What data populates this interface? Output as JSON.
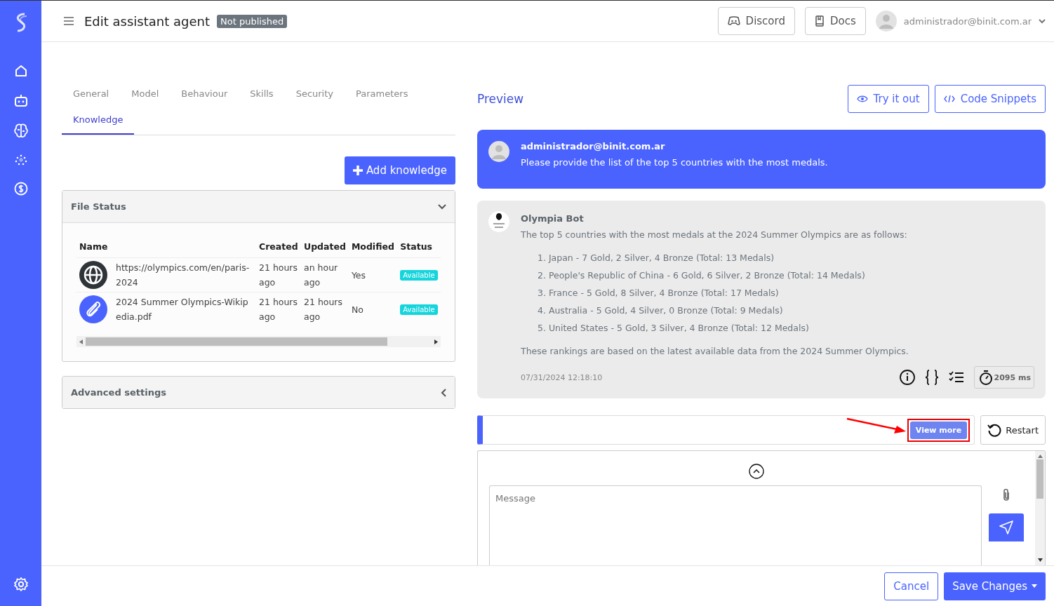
{
  "header": {
    "title": "Edit assistant agent",
    "status_badge": "Not published",
    "buttons": [
      {
        "kind": "discord",
        "label": "Discord"
      },
      {
        "kind": "docs",
        "label": "Docs"
      }
    ],
    "user": "administrador@binit.com.ar"
  },
  "sidebar": {
    "items": [
      {
        "kind": "home"
      },
      {
        "kind": "robot"
      },
      {
        "kind": "brain"
      },
      {
        "kind": "dots"
      },
      {
        "kind": "dollar"
      }
    ]
  },
  "tabs": [
    {
      "label": "General",
      "selected": false
    },
    {
      "label": "Model",
      "selected": false
    },
    {
      "label": "Behaviour",
      "selected": false
    },
    {
      "label": "Skills",
      "selected": false
    },
    {
      "label": "Security",
      "selected": false
    },
    {
      "label": "Parameters",
      "selected": false
    },
    {
      "label": "Knowledge",
      "selected": true
    }
  ],
  "add_button": "Add knowledge",
  "file_status": {
    "title": "File Status",
    "expanded": true,
    "columns": [
      "Name",
      "Created",
      "Updated",
      "Modified",
      "Status"
    ],
    "rows": [
      {
        "kind": "web",
        "name": "https://olympics.com/en/paris-2024",
        "created": "21 hours ago",
        "updated": "an hour ago",
        "modified": "Yes",
        "status": "Available"
      },
      {
        "kind": "file",
        "name": "2024 Summer Olympics-Wikipedia.pdf",
        "created": "21 hours ago",
        "updated": "21 hours ago",
        "modified": "No",
        "status": "Available"
      }
    ]
  },
  "advanced": {
    "title": "Advanced settings",
    "expanded": false
  },
  "preview": {
    "title": "Preview",
    "buttons": [
      {
        "kind": "eye",
        "label": "Try it out"
      },
      {
        "kind": "code",
        "label": "Code Snippets"
      }
    ],
    "user_message": {
      "author": "administrador@binit.com.ar",
      "text": "Please provide the list of the top 5 countries with the most medals."
    },
    "bot_message": {
      "author": "Olympia Bot",
      "intro": "The top 5 countries with the most medals at the 2024 Summer Olympics are as follows:",
      "list": [
        "1. Japan - 7 Gold, 2 Silver, 4 Bronze (Total: 13 Medals)",
        "2. People's Republic of China - 6 Gold, 6 Silver, 2 Bronze (Total: 14 Medals)",
        "3. France - 5 Gold, 8 Silver, 4 Bronze (Total: 17 Medals)",
        "4. Australia - 5 Gold, 4 Silver, 0 Bronze (Total: 9 Medals)",
        "5. United States - 5 Gold, 3 Silver, 4 Bronze (Total: 12 Medals)"
      ],
      "outro": "These rankings are based on the latest available data from the 2024 Summer Olympics.",
      "time": "07/31/2024 12:18:10",
      "duration": "2095 ms"
    },
    "view_more": {
      "label": "View more",
      "highlighted": true
    },
    "restart": "Restart",
    "message_placeholder": "Message"
  },
  "footer": {
    "cancel": "Cancel",
    "save": "Save Changes"
  }
}
